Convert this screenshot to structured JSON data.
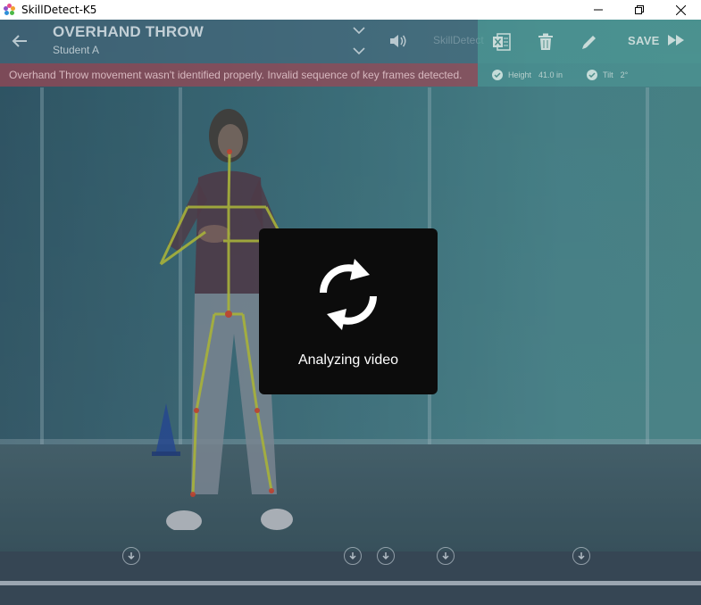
{
  "window": {
    "title": "SkillDetect-K5",
    "controls": [
      "minimize-icon",
      "restore-icon",
      "close-icon"
    ]
  },
  "header": {
    "skill_title": "OVERHAND THROW",
    "student_name": "Student A",
    "ghost_label": "SkillDetect"
  },
  "toolbar": {
    "buttons": [
      "excel-icon",
      "trash-icon",
      "pencil-icon"
    ],
    "save_label": "SAVE"
  },
  "error_banner": {
    "message": "Overhand Throw movement wasn't identified properly. Invalid sequence of key frames detected."
  },
  "measurements": {
    "height_label": "Height",
    "height_value": "41.0 in",
    "tilt_label": "Tilt",
    "tilt_value": "2°"
  },
  "timeline": {
    "keyframe_markers": 5
  },
  "modal": {
    "icon": "refresh-icon",
    "message": "Analyzing video"
  },
  "colors": {
    "skeleton": "#c8d13a",
    "joint": "#e0472f",
    "error_bg": "#9b4655",
    "toolbar_bg": "#50a09b"
  }
}
